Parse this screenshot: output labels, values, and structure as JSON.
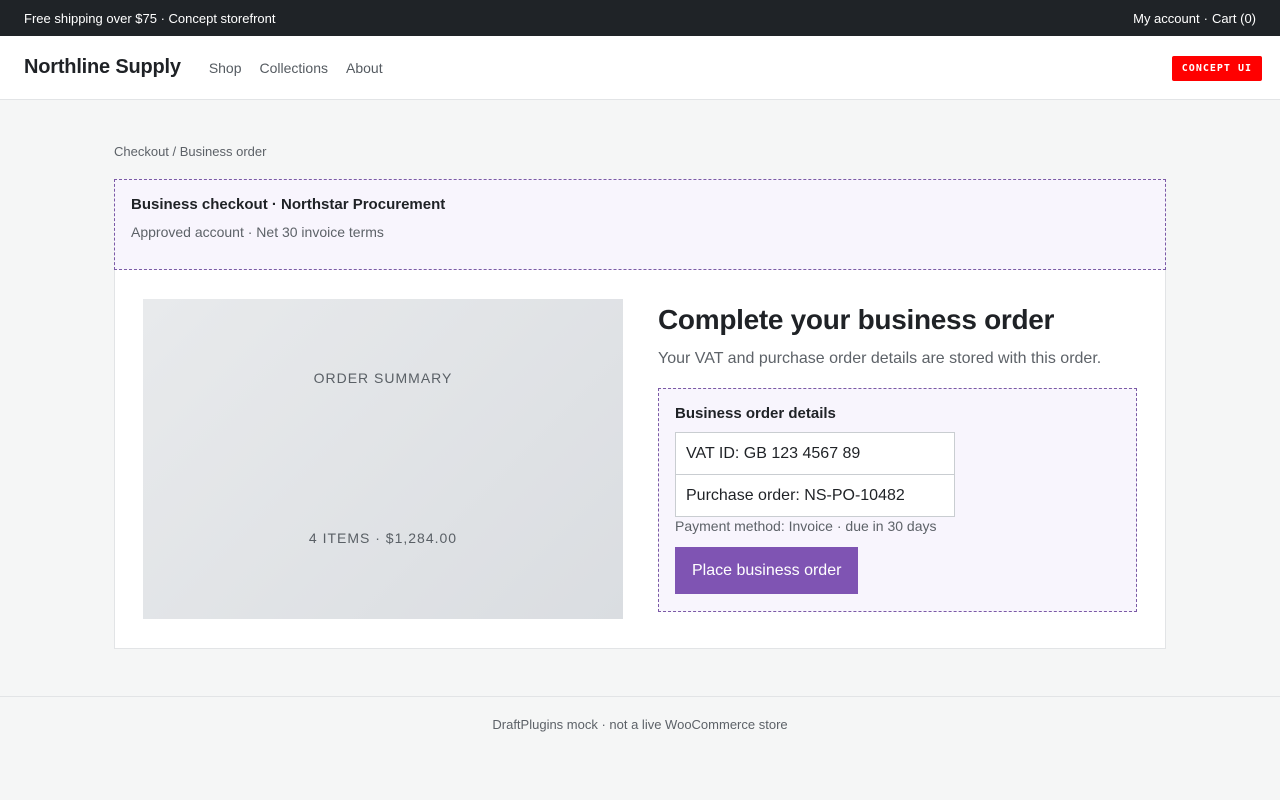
{
  "topbar": {
    "promo": "Free shipping over $75 · Concept storefront",
    "account": "My account",
    "separator": "·",
    "cart": "Cart (0)"
  },
  "header": {
    "brand": "Northline Supply",
    "nav": [
      "Shop",
      "Collections",
      "About"
    ],
    "badge": "CONCEPT UI"
  },
  "breadcrumb": "Checkout / Business order",
  "notice": {
    "title": "Business checkout · Northstar Procurement",
    "subtitle": "Approved account · Net 30 invoice terms"
  },
  "summary": {
    "label": "ORDER SUMMARY",
    "items": "4 ITEMS · $1,284.00"
  },
  "form": {
    "heading": "Complete your business order",
    "subtext": "Your VAT and purchase order details are stored with this order.",
    "details_title": "Business order details",
    "vat_value": "VAT ID: GB 123 4567 89",
    "po_value": "Purchase order: NS-PO-10482",
    "payment": "Payment method: Invoice · due in 30 days",
    "submit_label": "Place business order"
  },
  "footer": "DraftPlugins mock · not a live WooCommerce store",
  "colors": {
    "topbar_bg": "#1f2327",
    "accent": "#7f54b3",
    "badge_bg": "#ff0000",
    "notice_bg": "#f8f5fd"
  }
}
